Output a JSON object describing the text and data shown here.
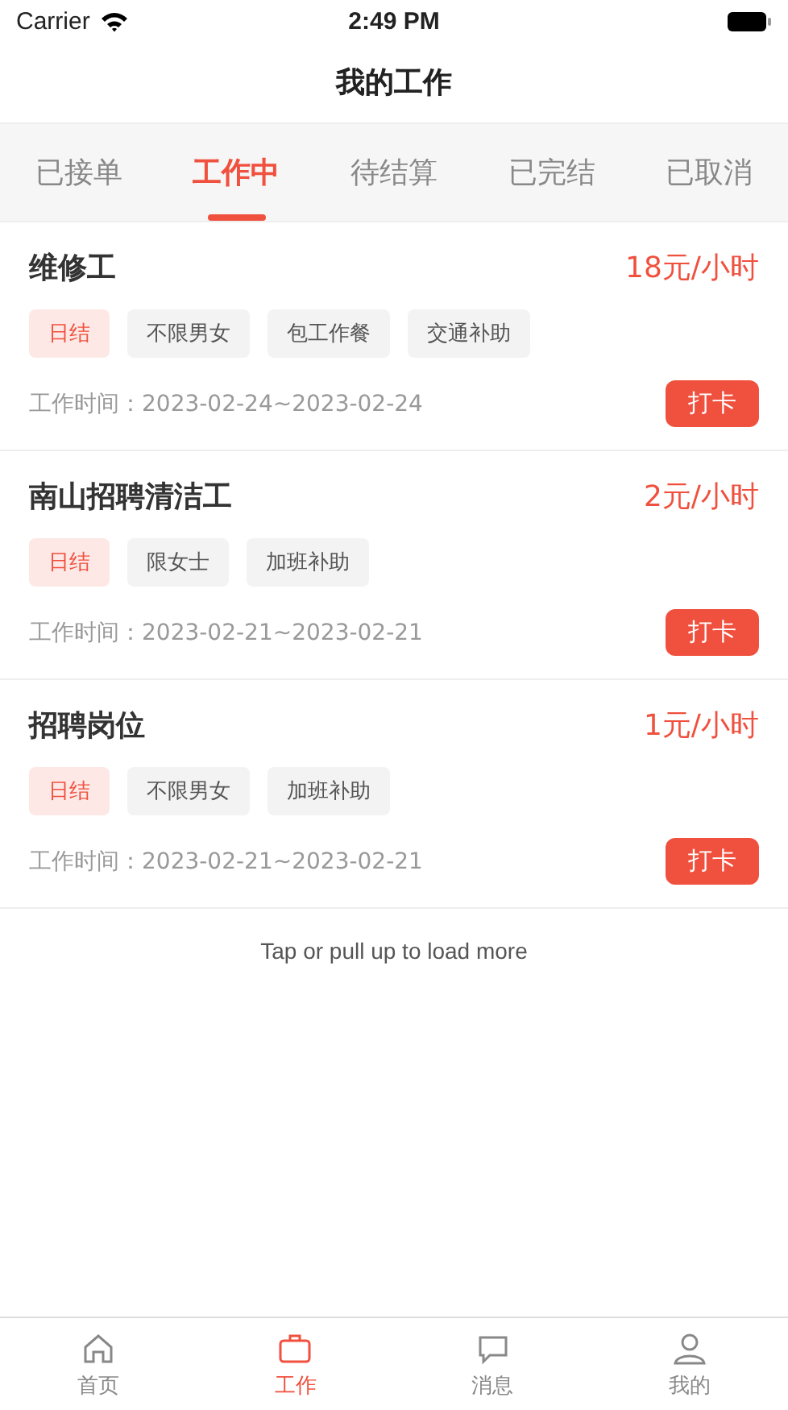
{
  "status_bar": {
    "carrier": "Carrier",
    "time": "2:49 PM"
  },
  "title": "我的工作",
  "tabs": [
    {
      "label": "已接单",
      "selected": false
    },
    {
      "label": "工作中",
      "selected": true
    },
    {
      "label": "待结算",
      "selected": false
    },
    {
      "label": "已完结",
      "selected": false
    },
    {
      "label": "已取消",
      "selected": false
    }
  ],
  "jobs": [
    {
      "name": "维修工",
      "pay": "18元/小时",
      "tags": [
        {
          "label": "日结",
          "kind": "highlight"
        },
        {
          "label": "不限男女",
          "kind": "plain"
        },
        {
          "label": "包工作餐",
          "kind": "plain"
        },
        {
          "label": "交通补助",
          "kind": "plain"
        }
      ],
      "time": "工作时间：2023-02-24~2023-02-24",
      "action": "打卡"
    },
    {
      "name": "南山招聘清洁工",
      "pay": "2元/小时",
      "tags": [
        {
          "label": "日结",
          "kind": "highlight"
        },
        {
          "label": "限女士",
          "kind": "plain"
        },
        {
          "label": "加班补助",
          "kind": "plain"
        }
      ],
      "time": "工作时间：2023-02-21~2023-02-21",
      "action": "打卡"
    },
    {
      "name": "招聘岗位",
      "pay": "1元/小时",
      "tags": [
        {
          "label": "日结",
          "kind": "highlight"
        },
        {
          "label": "不限男女",
          "kind": "plain"
        },
        {
          "label": "加班补助",
          "kind": "plain"
        }
      ],
      "time": "工作时间：2023-02-21~2023-02-21",
      "action": "打卡"
    }
  ],
  "load_more": "Tap or pull up to load more",
  "tab_bar": [
    {
      "label": "首页",
      "kind": "home",
      "selected": false
    },
    {
      "label": "工作",
      "kind": "work",
      "selected": true
    },
    {
      "label": "消息",
      "kind": "message",
      "selected": false
    },
    {
      "label": "我的",
      "kind": "person",
      "selected": false
    }
  ]
}
